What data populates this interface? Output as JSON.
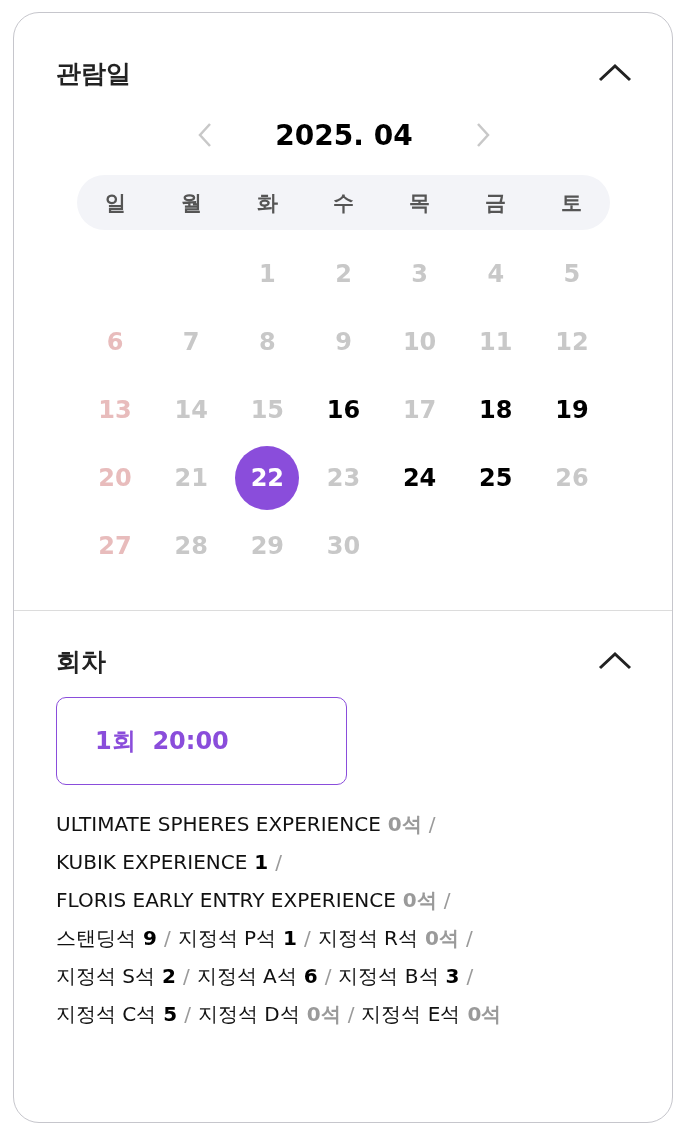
{
  "date_section": {
    "title": "관람일",
    "expanded": true,
    "month": "2025. 04",
    "weekdays": [
      "일",
      "월",
      "화",
      "수",
      "목",
      "금",
      "토"
    ],
    "weeks": [
      {
        "kind": "first",
        "days": [
          {
            "label": "1",
            "available": false,
            "selected": false
          },
          {
            "label": "2",
            "available": false,
            "selected": false
          },
          {
            "label": "3",
            "available": false,
            "selected": false
          },
          {
            "label": "4",
            "available": false,
            "selected": false
          },
          {
            "label": "5",
            "available": false,
            "selected": false
          }
        ]
      },
      {
        "kind": "week",
        "days": [
          {
            "label": "6",
            "available": false,
            "selected": false
          },
          {
            "label": "7",
            "available": false,
            "selected": false
          },
          {
            "label": "8",
            "available": false,
            "selected": false
          },
          {
            "label": "9",
            "available": false,
            "selected": false
          },
          {
            "label": "10",
            "available": false,
            "selected": false
          },
          {
            "label": "11",
            "available": false,
            "selected": false
          },
          {
            "label": "12",
            "available": false,
            "selected": false
          }
        ]
      },
      {
        "kind": "week",
        "days": [
          {
            "label": "13",
            "available": false,
            "selected": false
          },
          {
            "label": "14",
            "available": false,
            "selected": false
          },
          {
            "label": "15",
            "available": false,
            "selected": false
          },
          {
            "label": "16",
            "available": true,
            "selected": false
          },
          {
            "label": "17",
            "available": false,
            "selected": false
          },
          {
            "label": "18",
            "available": true,
            "selected": false
          },
          {
            "label": "19",
            "available": true,
            "selected": false
          }
        ]
      },
      {
        "kind": "week",
        "days": [
          {
            "label": "20",
            "available": false,
            "selected": false
          },
          {
            "label": "21",
            "available": false,
            "selected": false
          },
          {
            "label": "22",
            "available": true,
            "selected": true
          },
          {
            "label": "23",
            "available": false,
            "selected": false
          },
          {
            "label": "24",
            "available": true,
            "selected": false
          },
          {
            "label": "25",
            "available": true,
            "selected": false
          },
          {
            "label": "26",
            "available": false,
            "selected": false
          }
        ]
      },
      {
        "kind": "week",
        "days": [
          {
            "label": "27",
            "available": false,
            "selected": false
          },
          {
            "label": "28",
            "available": false,
            "selected": false
          },
          {
            "label": "29",
            "available": false,
            "selected": false
          },
          {
            "label": "30",
            "available": false,
            "selected": false
          }
        ]
      }
    ]
  },
  "session_section": {
    "title": "회차",
    "expanded": true,
    "sessions": [
      {
        "number": "1회",
        "time": "20:00",
        "selected": true
      }
    ],
    "separator": "/",
    "seat_lines": [
      [
        {
          "name": "ULTIMATE SPHERES EXPERIENCE",
          "count": "0석",
          "available": false
        }
      ],
      [
        {
          "name": "KUBIK EXPERIENCE",
          "count": "1",
          "available": true
        }
      ],
      [
        {
          "name": "FLORIS EARLY ENTRY EXPERIENCE",
          "count": "0석",
          "available": false
        }
      ],
      [
        {
          "name": "스탠딩석",
          "count": "9",
          "available": true
        },
        {
          "name": "지정석 P석",
          "count": "1",
          "available": true
        },
        {
          "name": "지정석 R석",
          "count": "0석",
          "available": false
        }
      ],
      [
        {
          "name": "지정석 S석",
          "count": "2",
          "available": true
        },
        {
          "name": "지정석 A석",
          "count": "6",
          "available": true
        },
        {
          "name": "지정석 B석",
          "count": "3",
          "available": true
        }
      ],
      [
        {
          "name": "지정석 C석",
          "count": "5",
          "available": true
        },
        {
          "name": "지정석 D석",
          "count": "0석",
          "available": false
        },
        {
          "name": "지정석 E석",
          "count": "0석",
          "available": false
        }
      ]
    ]
  }
}
